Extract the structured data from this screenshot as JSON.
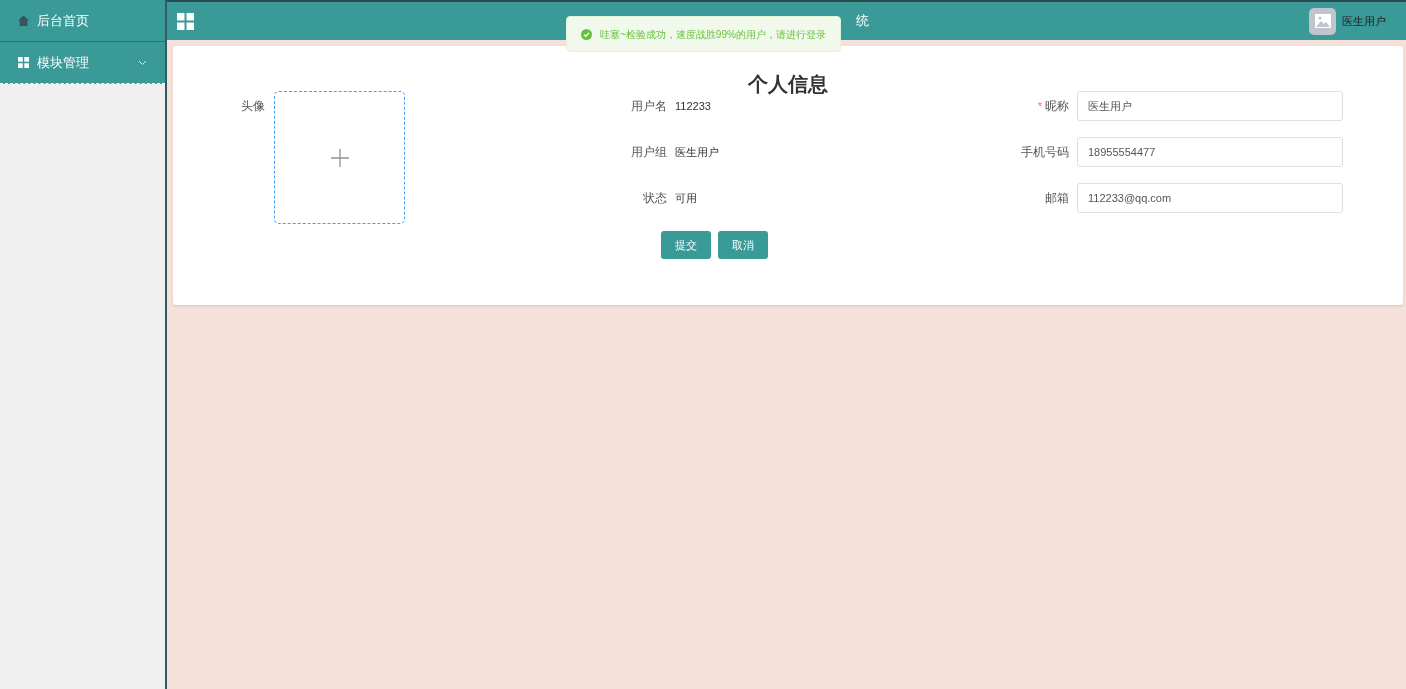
{
  "sidebar": {
    "items": [
      {
        "kind": "link",
        "label": "后台首页"
      },
      {
        "kind": "group",
        "label": "模块管理"
      }
    ]
  },
  "header": {
    "title": "统",
    "user": "医生用户"
  },
  "toast": {
    "message": "哇塞~检验成功，速度战胜99%的用户，请进行登录"
  },
  "form": {
    "title": "个人信息",
    "avatar_label": "头像",
    "info": [
      {
        "label": "用户名",
        "value": "112233"
      },
      {
        "label": "用户组",
        "value": "医生用户"
      },
      {
        "label": "状态",
        "value": "可用"
      }
    ],
    "fields": [
      {
        "label": "昵称",
        "required_mark": "*",
        "value": "医生用户"
      },
      {
        "label": "手机号码",
        "value": "18955554477"
      },
      {
        "label": "邮箱",
        "value": "112233@qq.com"
      }
    ],
    "buttons": [
      "提交",
      "取消"
    ]
  }
}
